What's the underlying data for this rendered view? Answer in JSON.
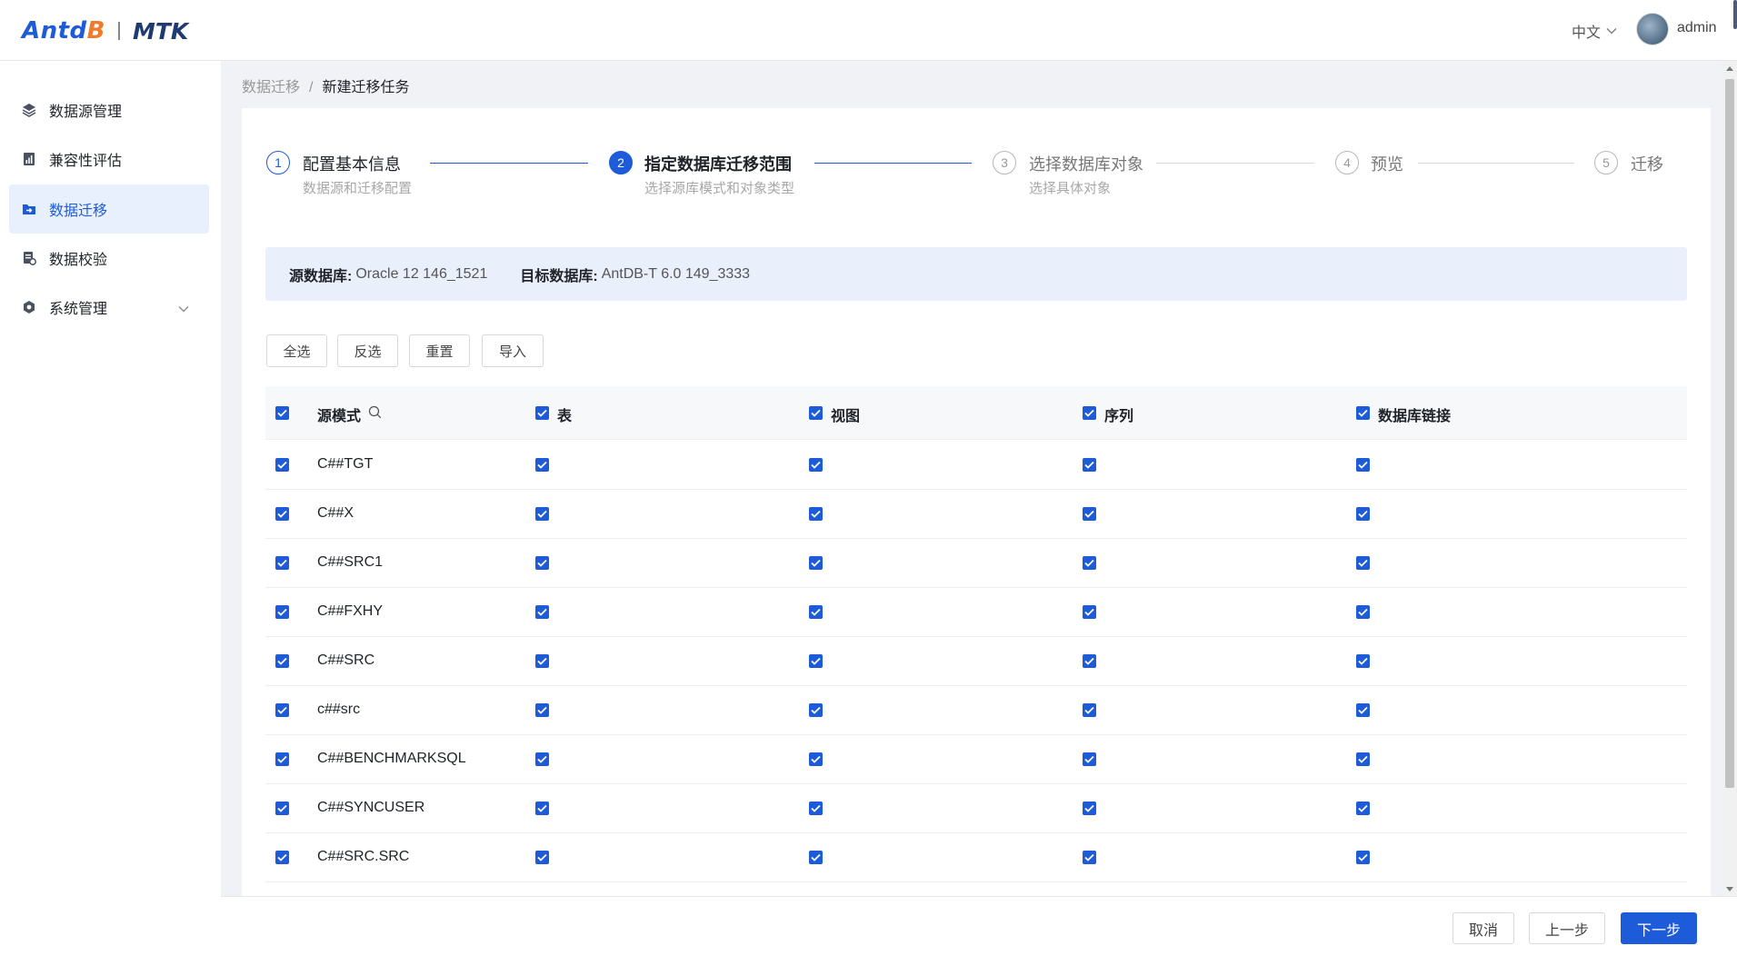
{
  "header": {
    "logo_brand_prefix": "Antd",
    "logo_brand_suffix": "B",
    "logo_product": "MTK",
    "language": "中文",
    "username": "admin"
  },
  "sidebar": {
    "items": [
      {
        "label": "数据源管理",
        "icon": "layers-icon"
      },
      {
        "label": "兼容性评估",
        "icon": "report-icon"
      },
      {
        "label": "数据迁移",
        "icon": "migrate-icon",
        "active": true
      },
      {
        "label": "数据校验",
        "icon": "verify-icon"
      },
      {
        "label": "系统管理",
        "icon": "settings-icon",
        "expandable": true
      }
    ]
  },
  "breadcrumb": {
    "parent": "数据迁移",
    "separator": "/",
    "current": "新建迁移任务"
  },
  "steps": [
    {
      "number": "1",
      "title": "配置基本信息",
      "desc": "数据源和迁移配置",
      "status": "done"
    },
    {
      "number": "2",
      "title": "指定数据库迁移范围",
      "desc": "选择源库模式和对象类型",
      "status": "current"
    },
    {
      "number": "3",
      "title": "选择数据库对象",
      "desc": "选择具体对象",
      "status": "todo"
    },
    {
      "number": "4",
      "title": "预览",
      "desc": "",
      "status": "todo"
    },
    {
      "number": "5",
      "title": "迁移",
      "desc": "",
      "status": "todo"
    }
  ],
  "info": {
    "source_label": "源数据库:",
    "source_value": "Oracle 12 146_1521",
    "target_label": "目标数据库:",
    "target_value": "AntDB-T 6.0 149_3333"
  },
  "toolbar": {
    "select_all": "全选",
    "invert": "反选",
    "reset": "重置",
    "import": "导入"
  },
  "table": {
    "columns": [
      "源模式",
      "表",
      "视图",
      "序列",
      "数据库链接"
    ],
    "rows": [
      {
        "schema": "C##TGT"
      },
      {
        "schema": "C##X"
      },
      {
        "schema": "C##SRC1"
      },
      {
        "schema": "C##FXHY"
      },
      {
        "schema": "C##SRC"
      },
      {
        "schema": "c##src"
      },
      {
        "schema": "C##BENCHMARKSQL"
      },
      {
        "schema": "C##SYNCUSER"
      },
      {
        "schema": "C##SRC.SRC"
      }
    ]
  },
  "footer": {
    "cancel": "取消",
    "prev": "上一步",
    "next": "下一步"
  },
  "colors": {
    "primary": "#1d5bd8",
    "brand_accent": "#ef7b2b",
    "info_bg": "#e9f0fb"
  }
}
